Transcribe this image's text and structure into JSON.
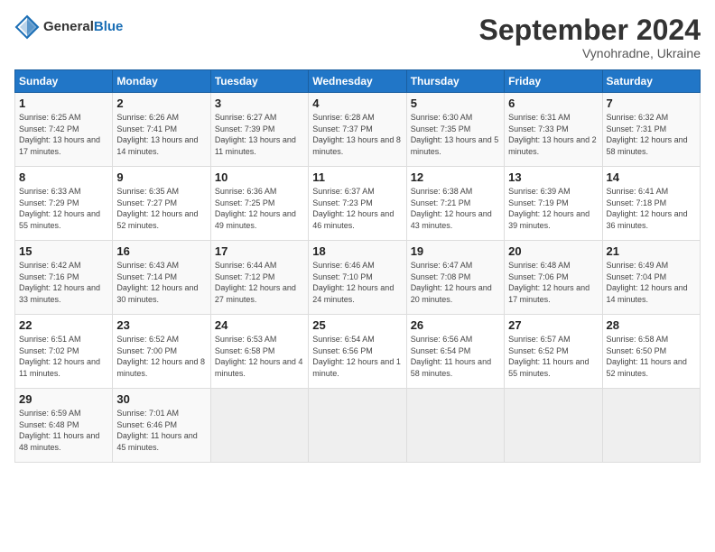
{
  "header": {
    "logo_general": "General",
    "logo_blue": "Blue",
    "month_title": "September 2024",
    "subtitle": "Vynohradne, Ukraine"
  },
  "weekdays": [
    "Sunday",
    "Monday",
    "Tuesday",
    "Wednesday",
    "Thursday",
    "Friday",
    "Saturday"
  ],
  "weeks": [
    [
      {
        "day": "1",
        "sunrise": "Sunrise: 6:25 AM",
        "sunset": "Sunset: 7:42 PM",
        "daylight": "Daylight: 13 hours and 17 minutes."
      },
      {
        "day": "2",
        "sunrise": "Sunrise: 6:26 AM",
        "sunset": "Sunset: 7:41 PM",
        "daylight": "Daylight: 13 hours and 14 minutes."
      },
      {
        "day": "3",
        "sunrise": "Sunrise: 6:27 AM",
        "sunset": "Sunset: 7:39 PM",
        "daylight": "Daylight: 13 hours and 11 minutes."
      },
      {
        "day": "4",
        "sunrise": "Sunrise: 6:28 AM",
        "sunset": "Sunset: 7:37 PM",
        "daylight": "Daylight: 13 hours and 8 minutes."
      },
      {
        "day": "5",
        "sunrise": "Sunrise: 6:30 AM",
        "sunset": "Sunset: 7:35 PM",
        "daylight": "Daylight: 13 hours and 5 minutes."
      },
      {
        "day": "6",
        "sunrise": "Sunrise: 6:31 AM",
        "sunset": "Sunset: 7:33 PM",
        "daylight": "Daylight: 13 hours and 2 minutes."
      },
      {
        "day": "7",
        "sunrise": "Sunrise: 6:32 AM",
        "sunset": "Sunset: 7:31 PM",
        "daylight": "Daylight: 12 hours and 58 minutes."
      }
    ],
    [
      {
        "day": "8",
        "sunrise": "Sunrise: 6:33 AM",
        "sunset": "Sunset: 7:29 PM",
        "daylight": "Daylight: 12 hours and 55 minutes."
      },
      {
        "day": "9",
        "sunrise": "Sunrise: 6:35 AM",
        "sunset": "Sunset: 7:27 PM",
        "daylight": "Daylight: 12 hours and 52 minutes."
      },
      {
        "day": "10",
        "sunrise": "Sunrise: 6:36 AM",
        "sunset": "Sunset: 7:25 PM",
        "daylight": "Daylight: 12 hours and 49 minutes."
      },
      {
        "day": "11",
        "sunrise": "Sunrise: 6:37 AM",
        "sunset": "Sunset: 7:23 PM",
        "daylight": "Daylight: 12 hours and 46 minutes."
      },
      {
        "day": "12",
        "sunrise": "Sunrise: 6:38 AM",
        "sunset": "Sunset: 7:21 PM",
        "daylight": "Daylight: 12 hours and 43 minutes."
      },
      {
        "day": "13",
        "sunrise": "Sunrise: 6:39 AM",
        "sunset": "Sunset: 7:19 PM",
        "daylight": "Daylight: 12 hours and 39 minutes."
      },
      {
        "day": "14",
        "sunrise": "Sunrise: 6:41 AM",
        "sunset": "Sunset: 7:18 PM",
        "daylight": "Daylight: 12 hours and 36 minutes."
      }
    ],
    [
      {
        "day": "15",
        "sunrise": "Sunrise: 6:42 AM",
        "sunset": "Sunset: 7:16 PM",
        "daylight": "Daylight: 12 hours and 33 minutes."
      },
      {
        "day": "16",
        "sunrise": "Sunrise: 6:43 AM",
        "sunset": "Sunset: 7:14 PM",
        "daylight": "Daylight: 12 hours and 30 minutes."
      },
      {
        "day": "17",
        "sunrise": "Sunrise: 6:44 AM",
        "sunset": "Sunset: 7:12 PM",
        "daylight": "Daylight: 12 hours and 27 minutes."
      },
      {
        "day": "18",
        "sunrise": "Sunrise: 6:46 AM",
        "sunset": "Sunset: 7:10 PM",
        "daylight": "Daylight: 12 hours and 24 minutes."
      },
      {
        "day": "19",
        "sunrise": "Sunrise: 6:47 AM",
        "sunset": "Sunset: 7:08 PM",
        "daylight": "Daylight: 12 hours and 20 minutes."
      },
      {
        "day": "20",
        "sunrise": "Sunrise: 6:48 AM",
        "sunset": "Sunset: 7:06 PM",
        "daylight": "Daylight: 12 hours and 17 minutes."
      },
      {
        "day": "21",
        "sunrise": "Sunrise: 6:49 AM",
        "sunset": "Sunset: 7:04 PM",
        "daylight": "Daylight: 12 hours and 14 minutes."
      }
    ],
    [
      {
        "day": "22",
        "sunrise": "Sunrise: 6:51 AM",
        "sunset": "Sunset: 7:02 PM",
        "daylight": "Daylight: 12 hours and 11 minutes."
      },
      {
        "day": "23",
        "sunrise": "Sunrise: 6:52 AM",
        "sunset": "Sunset: 7:00 PM",
        "daylight": "Daylight: 12 hours and 8 minutes."
      },
      {
        "day": "24",
        "sunrise": "Sunrise: 6:53 AM",
        "sunset": "Sunset: 6:58 PM",
        "daylight": "Daylight: 12 hours and 4 minutes."
      },
      {
        "day": "25",
        "sunrise": "Sunrise: 6:54 AM",
        "sunset": "Sunset: 6:56 PM",
        "daylight": "Daylight: 12 hours and 1 minute."
      },
      {
        "day": "26",
        "sunrise": "Sunrise: 6:56 AM",
        "sunset": "Sunset: 6:54 PM",
        "daylight": "Daylight: 11 hours and 58 minutes."
      },
      {
        "day": "27",
        "sunrise": "Sunrise: 6:57 AM",
        "sunset": "Sunset: 6:52 PM",
        "daylight": "Daylight: 11 hours and 55 minutes."
      },
      {
        "day": "28",
        "sunrise": "Sunrise: 6:58 AM",
        "sunset": "Sunset: 6:50 PM",
        "daylight": "Daylight: 11 hours and 52 minutes."
      }
    ],
    [
      {
        "day": "29",
        "sunrise": "Sunrise: 6:59 AM",
        "sunset": "Sunset: 6:48 PM",
        "daylight": "Daylight: 11 hours and 48 minutes."
      },
      {
        "day": "30",
        "sunrise": "Sunrise: 7:01 AM",
        "sunset": "Sunset: 6:46 PM",
        "daylight": "Daylight: 11 hours and 45 minutes."
      },
      null,
      null,
      null,
      null,
      null
    ]
  ]
}
